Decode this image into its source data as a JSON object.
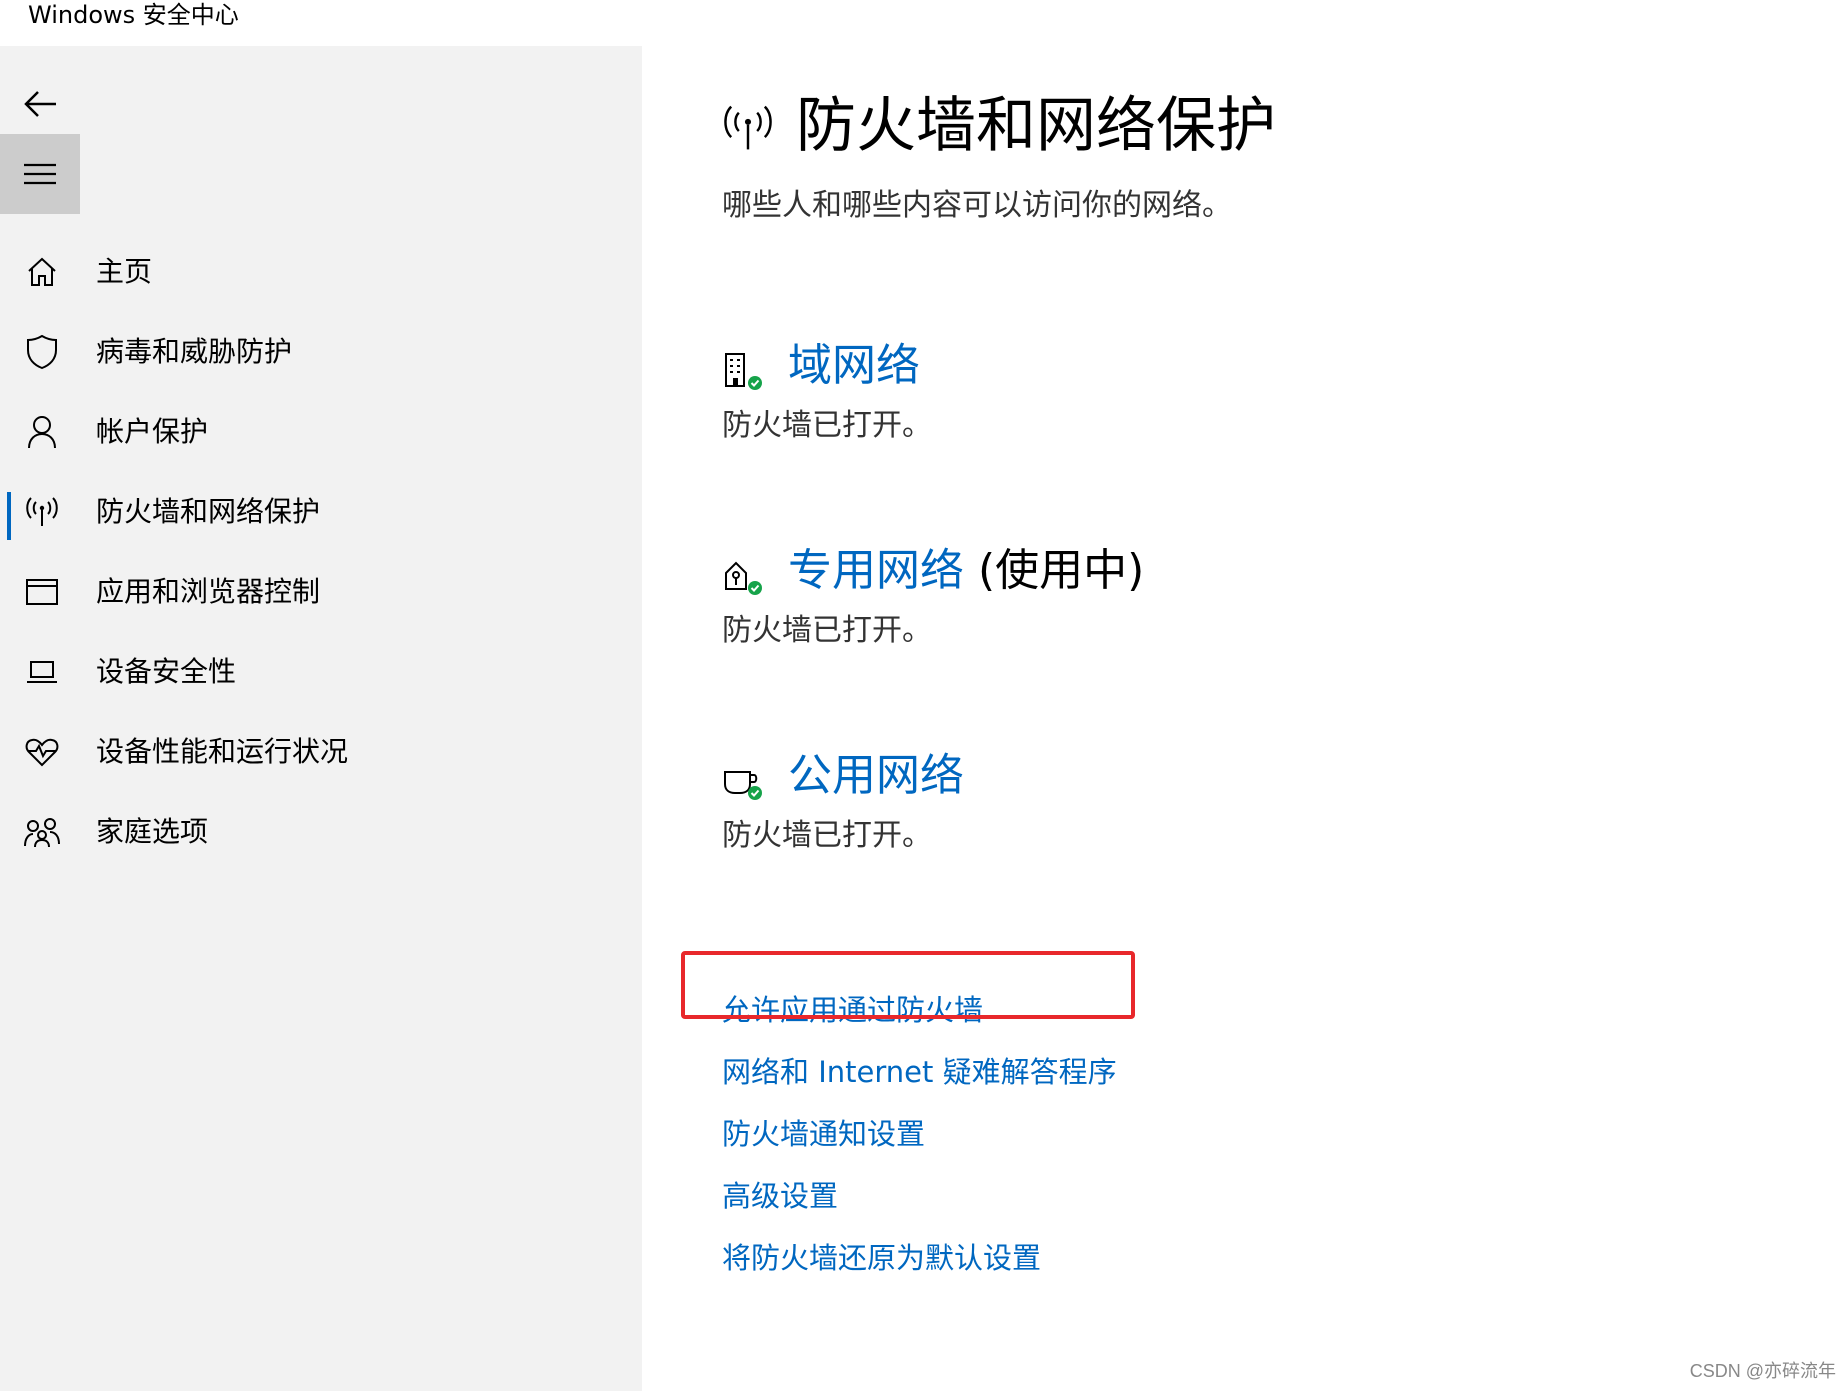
{
  "window": {
    "title": "Windows 安全中心"
  },
  "sidebar": {
    "back_icon": "back-arrow-icon",
    "menu_icon": "hamburger-menu-icon",
    "items": [
      {
        "label": "主页",
        "icon": "home-icon"
      },
      {
        "label": "病毒和威胁防护",
        "icon": "shield-icon"
      },
      {
        "label": "帐户保护",
        "icon": "person-icon"
      },
      {
        "label": "防火墙和网络保护",
        "icon": "antenna-icon",
        "active": true
      },
      {
        "label": "应用和浏览器控制",
        "icon": "browser-window-icon"
      },
      {
        "label": "设备安全性",
        "icon": "laptop-icon"
      },
      {
        "label": "设备性能和运行状况",
        "icon": "heart-pulse-icon"
      },
      {
        "label": "家庭选项",
        "icon": "family-icon"
      }
    ]
  },
  "main": {
    "title": "防火墙和网络保护",
    "subtitle": "哪些人和哪些内容可以访问你的网络。",
    "networks": [
      {
        "name": "域网络",
        "suffix": "",
        "status": "防火墙已打开。",
        "icon": "domain-network-icon"
      },
      {
        "name": "专用网络",
        "suffix": " (使用中)",
        "status": "防火墙已打开。",
        "icon": "private-network-icon"
      },
      {
        "name": "公用网络",
        "suffix": "",
        "status": "防火墙已打开。",
        "icon": "public-network-icon"
      }
    ],
    "links": [
      "允许应用通过防火墙",
      "网络和 Internet 疑难解答程序",
      "防火墙通知设置",
      "高级设置",
      "将防火墙还原为默认设置"
    ]
  },
  "colors": {
    "accent": "#0067c0",
    "sidebar_bg": "#f2f2f2",
    "highlight": "#e8282b",
    "status_ok": "#16a34a"
  },
  "watermark": "CSDN @亦碎流年"
}
